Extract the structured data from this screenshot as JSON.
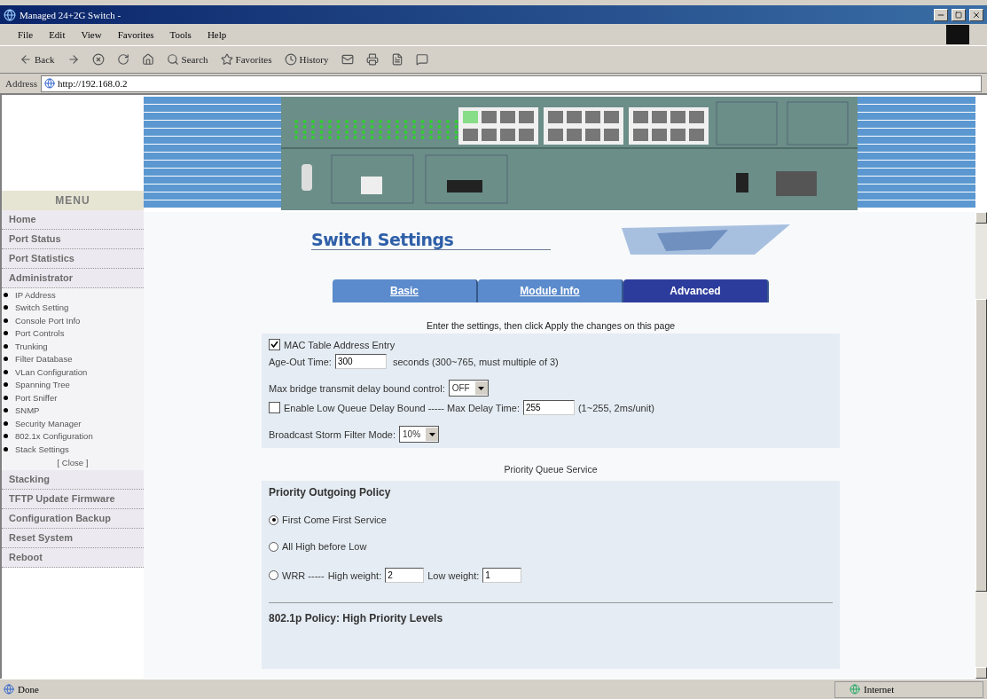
{
  "window": {
    "title": "Managed 24+2G Switch -"
  },
  "menu_bar": [
    "File",
    "Edit",
    "View",
    "Favorites",
    "Tools",
    "Help"
  ],
  "toolbar": [
    {
      "kind": "back",
      "label": "Back"
    },
    {
      "kind": "forward"
    },
    {
      "kind": "stop"
    },
    {
      "kind": "refresh"
    },
    {
      "kind": "home"
    },
    {
      "kind": "search",
      "label": "Search"
    },
    {
      "kind": "favorites",
      "label": "Favorites"
    },
    {
      "kind": "history",
      "label": "History"
    },
    {
      "kind": "mail"
    },
    {
      "kind": "print"
    },
    {
      "kind": "edit"
    },
    {
      "kind": "discuss"
    }
  ],
  "address": {
    "label": "Address",
    "value": "http://192.168.0.2"
  },
  "sidebar": {
    "header": "MENU",
    "items": [
      {
        "kind": "main",
        "label": "Home"
      },
      {
        "kind": "main",
        "label": "Port Status"
      },
      {
        "kind": "main",
        "label": "Port Statistics"
      },
      {
        "kind": "main",
        "label": "Administrator"
      },
      {
        "kind": "sub",
        "label": "IP Address"
      },
      {
        "kind": "sub",
        "label": "Switch Setting"
      },
      {
        "kind": "sub",
        "label": "Console Port Info"
      },
      {
        "kind": "sub",
        "label": "Port Controls"
      },
      {
        "kind": "sub",
        "label": "Trunking"
      },
      {
        "kind": "sub",
        "label": "Filter Database"
      },
      {
        "kind": "sub",
        "label": "VLan Configuration"
      },
      {
        "kind": "sub",
        "label": "Spanning Tree"
      },
      {
        "kind": "sub",
        "label": "Port Sniffer"
      },
      {
        "kind": "sub",
        "label": "SNMP"
      },
      {
        "kind": "sub",
        "label": "Security Manager"
      },
      {
        "kind": "sub",
        "label": "802.1x Configuration"
      },
      {
        "kind": "sub",
        "label": "Stack Settings"
      },
      {
        "kind": "close",
        "label": "[ Close ]"
      },
      {
        "kind": "main",
        "label": "Stacking"
      },
      {
        "kind": "main",
        "label": "TFTP Update Firmware"
      },
      {
        "kind": "main",
        "label": "Configuration Backup"
      },
      {
        "kind": "main",
        "label": "Reset System"
      },
      {
        "kind": "main",
        "label": "Reboot"
      }
    ]
  },
  "page": {
    "title": "Switch Settings",
    "tabs": [
      {
        "label": "Basic",
        "selected": false
      },
      {
        "label": "Module Info",
        "selected": false
      },
      {
        "label": "Advanced",
        "selected": true
      }
    ],
    "instruction": "Enter the settings, then click Apply the changes on this page",
    "mac_table": {
      "label": "MAC Table Address Entry",
      "checked": true
    },
    "age_out": {
      "label": "Age-Out Time:",
      "value": "300",
      "hint": "seconds (300~765, must multiple of 3)"
    },
    "max_bridge": {
      "label": "Max bridge transmit delay bound control:",
      "value": "OFF"
    },
    "low_queue": {
      "label": "Enable Low Queue Delay Bound ----- Max Delay Time:",
      "checked": false,
      "value": "255",
      "hint": "(1~255, 2ms/unit)"
    },
    "broadcast": {
      "label": "Broadcast Storm Filter Mode:",
      "value": "10%"
    },
    "priority": {
      "section_title": "Priority Queue Service",
      "heading": "Priority Outgoing Policy",
      "options": [
        {
          "kind": "plain",
          "label": "First Come First Service",
          "selected": true
        },
        {
          "kind": "plain",
          "label": "All High before Low",
          "selected": false
        },
        {
          "kind": "wrr",
          "label": "WRR -----",
          "selected": false,
          "high_label": "High weight:",
          "high_value": "2",
          "low_label": "Low weight:",
          "low_value": "1"
        }
      ],
      "next_heading": "802.1p Policy: High Priority Levels"
    }
  },
  "status_bar": {
    "text": "Done",
    "zone": "Internet"
  }
}
